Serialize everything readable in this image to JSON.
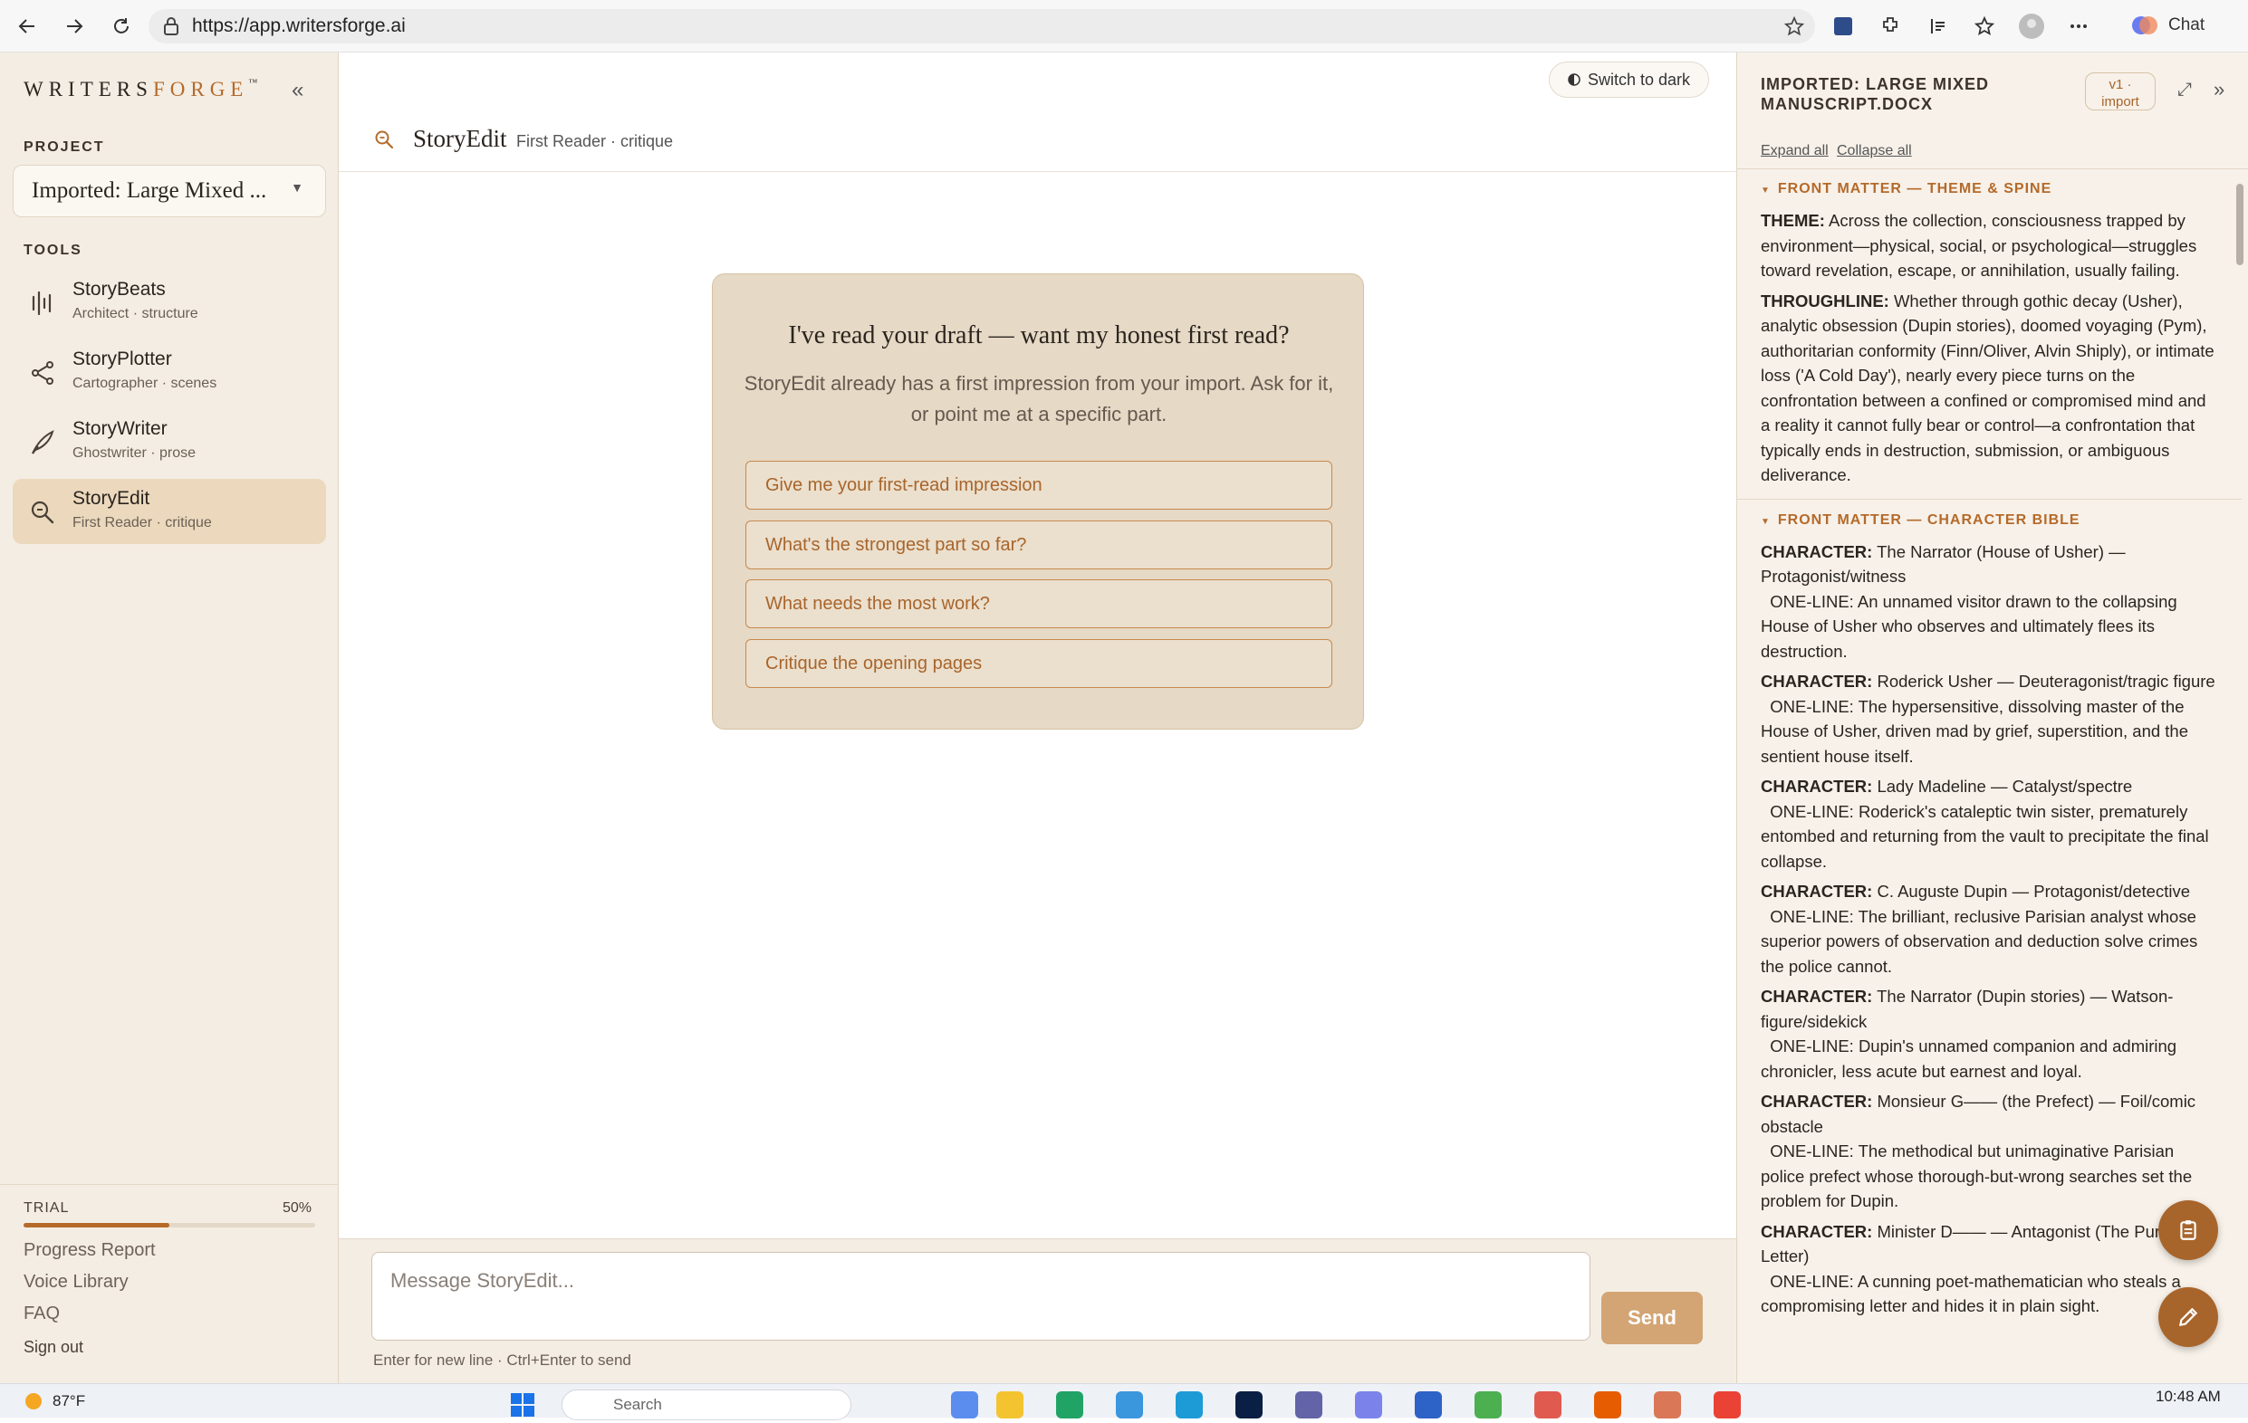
{
  "browser": {
    "url": "https://app.writersforge.ai",
    "chat_label": "Chat"
  },
  "sidebar": {
    "brand_main": "WRITERS",
    "brand_accent": "FORGE",
    "brand_tm": "™",
    "collapse_glyph": "«",
    "project_label": "PROJECT",
    "project_value": "Imported: Large Mixed ...",
    "tools_label": "TOOLS",
    "tools": [
      {
        "name": "StoryBeats",
        "sub": "Architect · structure",
        "icon": "bars-icon"
      },
      {
        "name": "StoryPlotter",
        "sub": "Cartographer · scenes",
        "icon": "share-nodes-icon"
      },
      {
        "name": "StoryWriter",
        "sub": "Ghostwriter · prose",
        "icon": "quill-icon"
      },
      {
        "name": "StoryEdit",
        "sub": "First Reader · critique",
        "icon": "magnifier-icon"
      }
    ],
    "trial_label": "TRIAL",
    "trial_percent_text": "50%",
    "trial_progress": 0.5,
    "links": [
      "Progress Report",
      "Voice Library",
      "FAQ"
    ],
    "sign_out": "Sign out"
  },
  "main": {
    "switch_dark": "Switch to dark",
    "tool_title": "StoryEdit",
    "tool_subtitle": "First Reader · critique",
    "card_title": "I've read your draft — want my honest first read?",
    "card_desc": "StoryEdit already has a first impression from your import. Ask for it, or point me at a specific part.",
    "suggestions": [
      "Give me your first-read impression",
      "What's the strongest part so far?",
      "What needs the most work?",
      "Critique the opening pages"
    ],
    "input_placeholder": "Message StoryEdit...",
    "send_label": "Send",
    "hint": "Enter for new line · Ctrl+Enter to send"
  },
  "panel": {
    "title": "IMPORTED: LARGE MIXED MANUSCRIPT.DOCX",
    "version_line1": "v1 ·",
    "version_line2": "import",
    "expand_all": "Expand all",
    "collapse_all": "Collapse all",
    "section1_head": "FRONT MATTER — THEME & SPINE",
    "theme_label": "THEME:",
    "theme_text": " Across the collection, consciousness trapped by environment—physical, social, or psychological—struggles toward revelation, escape, or annihilation, usually failing.",
    "throughline_label": "THROUGHLINE:",
    "throughline_text": " Whether through gothic decay (Usher), analytic obsession (Dupin stories), doomed voyaging (Pym), authoritarian conformity (Finn/Oliver, Alvin Shiply), or intimate loss ('A Cold Day'), nearly every piece turns on the confrontation between a confined or compromised mind and a reality it cannot fully bear or control—a confrontation that typically ends in destruction, submission, or ambiguous deliverance.",
    "section2_head": "FRONT MATTER — CHARACTER BIBLE",
    "character_label": "CHARACTER:",
    "characters": [
      {
        "name": " The Narrator (House of Usher) — Protagonist/witness",
        "oneline": "ONE-LINE: An unnamed visitor drawn to the collapsing House of Usher who observes and ultimately flees its destruction."
      },
      {
        "name": " Roderick Usher — Deuteragonist/tragic figure",
        "oneline": "ONE-LINE: The hypersensitive, dissolving master of the House of Usher, driven mad by grief, superstition, and the sentient house itself."
      },
      {
        "name": " Lady Madeline — Catalyst/spectre",
        "oneline": "ONE-LINE: Roderick's cataleptic twin sister, prematurely entombed and returning from the vault to precipitate the final collapse."
      },
      {
        "name": " C. Auguste Dupin — Protagonist/detective",
        "oneline": "ONE-LINE: The brilliant, reclusive Parisian analyst whose superior powers of observation and deduction solve crimes the police cannot."
      },
      {
        "name": " The Narrator (Dupin stories) — Watson-figure/sidekick",
        "oneline": "ONE-LINE: Dupin's unnamed companion and admiring chronicler, less acute but earnest and loyal."
      },
      {
        "name": " Monsieur G—— (the Prefect) — Foil/comic obstacle",
        "oneline": "ONE-LINE: The methodical but unimaginative Parisian police prefect whose thorough-but-wrong searches set the problem for Dupin."
      },
      {
        "name": " Minister D—— — Antagonist (The Purloined Letter)",
        "oneline": "ONE-LINE: A cunning poet-mathematician who steals a compromising letter and hides it in plain sight."
      }
    ]
  },
  "taskbar": {
    "weather": "87°F",
    "search": "Search",
    "time": "10:48 AM"
  }
}
